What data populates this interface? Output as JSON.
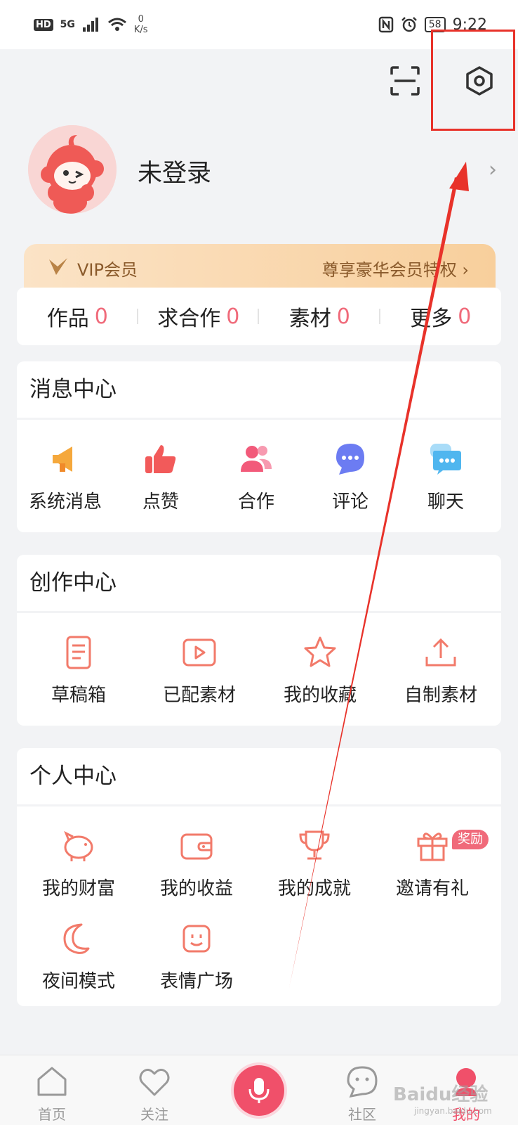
{
  "status_bar": {
    "hd": "HD",
    "network": "5G",
    "speed_value": "0",
    "speed_unit": "K/s",
    "battery": "58",
    "time": "9:22"
  },
  "profile": {
    "username": "未登录",
    "arrow": "›"
  },
  "vip": {
    "label": "VIP会员",
    "promo": "尊享豪华会员特权 ›"
  },
  "stats": [
    {
      "label": "作品",
      "count": "0"
    },
    {
      "label": "求合作",
      "count": "0"
    },
    {
      "label": "素材",
      "count": "0"
    },
    {
      "label": "更多",
      "count": "0"
    }
  ],
  "message_center": {
    "title": "消息中心",
    "items": [
      {
        "label": "系统消息",
        "icon": "megaphone-icon"
      },
      {
        "label": "点赞",
        "icon": "thumbs-up-icon"
      },
      {
        "label": "合作",
        "icon": "users-icon"
      },
      {
        "label": "评论",
        "icon": "comment-icon"
      },
      {
        "label": "聊天",
        "icon": "chat-icon"
      }
    ]
  },
  "creation_center": {
    "title": "创作中心",
    "items": [
      {
        "label": "草稿箱",
        "icon": "draft-icon"
      },
      {
        "label": "已配素材",
        "icon": "video-icon"
      },
      {
        "label": "我的收藏",
        "icon": "star-icon"
      },
      {
        "label": "自制素材",
        "icon": "upload-icon"
      }
    ]
  },
  "personal_center": {
    "title": "个人中心",
    "reward_badge": "奖励",
    "items": [
      {
        "label": "我的财富",
        "icon": "piggy-bank-icon"
      },
      {
        "label": "我的收益",
        "icon": "wallet-icon"
      },
      {
        "label": "我的成就",
        "icon": "trophy-icon"
      },
      {
        "label": "邀请有礼",
        "icon": "gift-icon"
      },
      {
        "label": "夜间模式",
        "icon": "moon-icon"
      },
      {
        "label": "表情广场",
        "icon": "emoji-icon"
      }
    ]
  },
  "tabbar": {
    "tabs": [
      {
        "label": "首页",
        "icon": "home-icon"
      },
      {
        "label": "关注",
        "icon": "heart-icon"
      },
      {
        "label": "",
        "icon": "microphone-icon"
      },
      {
        "label": "社区",
        "icon": "community-icon"
      },
      {
        "label": "我的",
        "icon": "profile-icon"
      }
    ]
  },
  "watermark": {
    "brand": "Baidu经验",
    "domain": "jingyan.baidu.com"
  },
  "colors": {
    "accent": "#f06a7a",
    "annotation_red": "#e8322a",
    "background": "#f2f3f5",
    "vip_gold": "#8a5a2b"
  }
}
